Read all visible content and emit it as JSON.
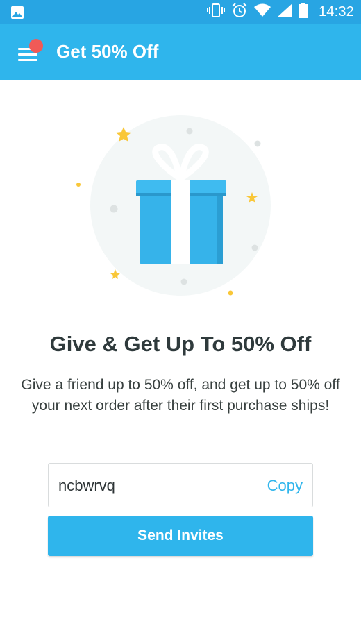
{
  "status_bar": {
    "time": "14:32",
    "icons": [
      "image-icon",
      "vibrate-icon",
      "alarm-icon",
      "wifi-icon",
      "signal-icon",
      "battery-icon"
    ]
  },
  "app_bar": {
    "title": "Get 50% Off",
    "menu_icon": "hamburger-menu-icon",
    "has_notification": true
  },
  "hero": {
    "illustration": "gift-box-icon",
    "headline": "Give & Get Up To 50% Off",
    "description": "Give a friend up to 50% off, and get up to 50% off your next order after their first purchase ships!"
  },
  "referral": {
    "code": "ncbwrvq",
    "copy_label": "Copy",
    "send_label": "Send Invites"
  },
  "colors": {
    "status_bar": "#28a5e3",
    "accent": "#2fb5ec",
    "notification": "#f05a57",
    "star": "#f9c738",
    "heading_text": "#2f3a3c"
  }
}
